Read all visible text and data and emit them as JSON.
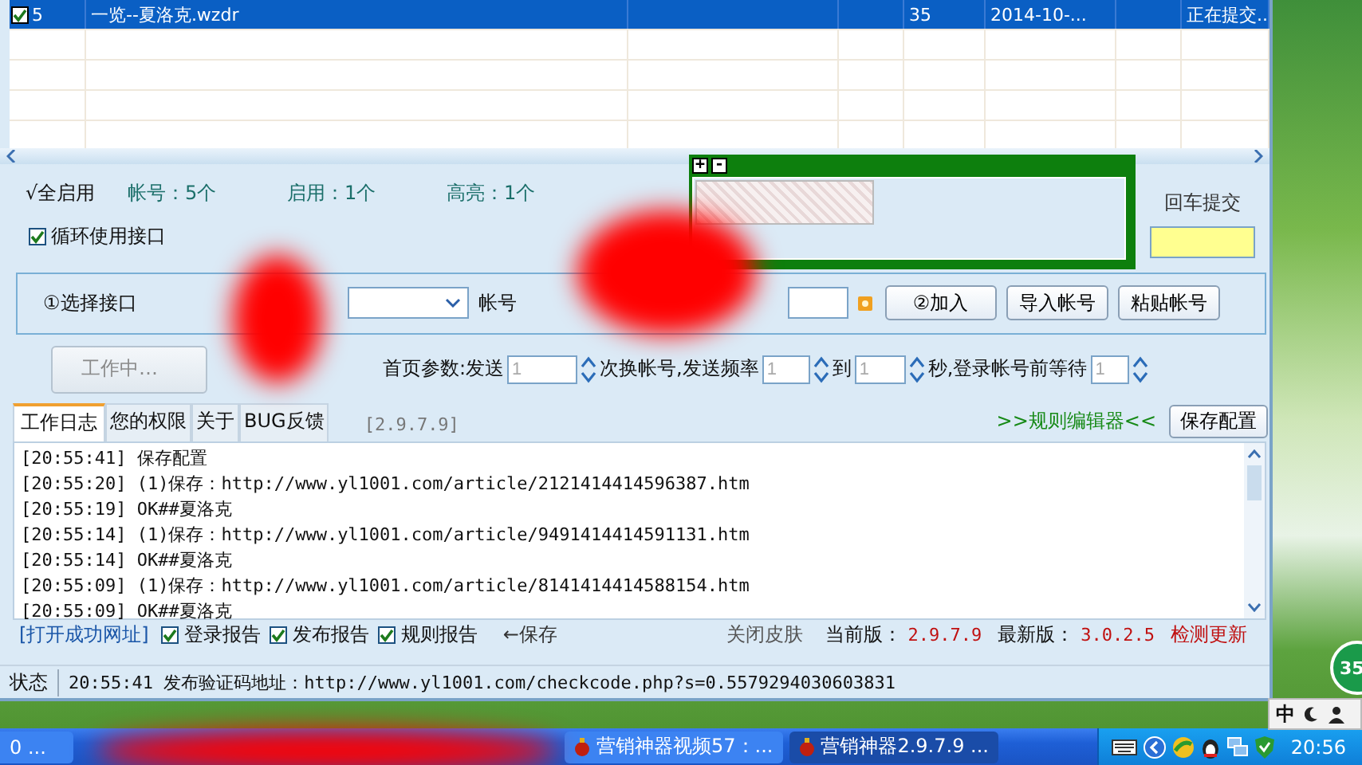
{
  "table": {
    "rows": [
      {
        "checked": true,
        "selected": true,
        "cells": [
          "5",
          "一览--夏洛克.wzdr",
          "",
          "",
          "35",
          "2014-10-...",
          "",
          "正在提交.."
        ]
      }
    ]
  },
  "summary": {
    "enable_all": "√全启用",
    "accounts": "帐号：5个",
    "enabled": "启用：1个",
    "highlighted": "高亮：1个"
  },
  "loop_interface": {
    "label": "循环使用接口",
    "checked": true
  },
  "captcha": {
    "zoom_in": "+",
    "zoom_out": "-"
  },
  "enter_submit": {
    "label": "回车提交"
  },
  "account_row": {
    "select_label": "①选择接口",
    "account_label": "帐号",
    "buttons": [
      "②加入",
      "导入帐号",
      "粘贴帐号"
    ]
  },
  "work_row": {
    "work_button": {
      "label": "工作中…",
      "disabled": true
    },
    "parts": [
      {
        "kind": "text",
        "text": "首页参数:发送"
      },
      {
        "kind": "spin",
        "value": "1"
      },
      {
        "kind": "text",
        "text": "次换帐号,发送频率"
      },
      {
        "kind": "spin",
        "value": "1"
      },
      {
        "kind": "text",
        "text": "到"
      },
      {
        "kind": "spin",
        "value": "1"
      },
      {
        "kind": "text",
        "text": "秒,登录帐号前等待"
      },
      {
        "kind": "spin",
        "value": "1"
      }
    ]
  },
  "tabs": [
    {
      "label": "工作日志",
      "selected": true
    },
    {
      "label": "您的权限",
      "selected": false
    },
    {
      "label": "关于",
      "selected": false
    },
    {
      "label": "BUG反馈",
      "selected": false
    }
  ],
  "version_tag": "[2.9.7.9]",
  "rule_editor": ">>规则编辑器<<",
  "save_config": "保存配置",
  "log": [
    "[20:55:41] 保存配置",
    "[20:55:20] (1)保存：http://www.yl1001.com/article/2121414414596387.htm",
    "[20:55:19] OK##夏洛克",
    "[20:55:14] (1)保存：http://www.yl1001.com/article/9491414414591131.htm",
    "[20:55:14] OK##夏洛克",
    "[20:55:09] (1)保存：http://www.yl1001.com/article/8141414414588154.htm",
    "[20:55:09] OK##夏洛克"
  ],
  "options": {
    "open_link": "[打开成功网址]",
    "checks": [
      {
        "label": "登录报告",
        "checked": true
      },
      {
        "label": "发布报告",
        "checked": true
      },
      {
        "label": "规则报告",
        "checked": true
      }
    ],
    "save": "←保存",
    "close_skin": "关闭皮肤",
    "current": {
      "label": "当前版：",
      "value": "2.9.7.9"
    },
    "latest": {
      "label": "最新版：",
      "value": "3.0.2.5"
    },
    "check_update": "检测更新"
  },
  "status_bar": {
    "label": "状态",
    "text": "20:55:41 发布验证码地址：http://www.yl1001.com/checkcode.php?s=0.5579294030603831"
  },
  "float_ball": "35",
  "ime": "中",
  "taskbar": {
    "items": [
      {
        "label": "0 ...",
        "selected": false
      },
      {
        "label": "营销神器视频57：...",
        "selected": false
      },
      {
        "label": "营销神器2.9.7.9 ...",
        "selected": true
      }
    ],
    "clock": "20:56"
  }
}
